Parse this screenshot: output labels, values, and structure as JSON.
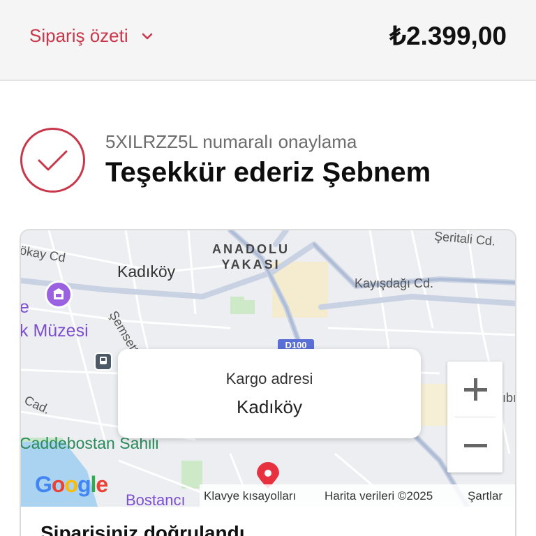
{
  "header": {
    "summary_label": "Sipariş özeti",
    "total": "₺2.399,00"
  },
  "confirmation": {
    "number_text": "5XILRZZ5L numaralı onaylama",
    "thanks_text": "Teşekkür ederiz Şebnem"
  },
  "map": {
    "labels": {
      "kadikoy": "Kadıköy",
      "anadolu": "ANADOLU",
      "yakasi": "YAKASI",
      "seritali": "Şeritali Cd.",
      "okay_cd": "ökay Cd",
      "kayisdagi": "Kayışdağı Cd.",
      "semsettin": "Şemsett",
      "muzesi": "k Müzesi",
      "e_label": "e",
      "cad": "Cad.",
      "caddebostan": "Caddebostan Sahili",
      "bostanci": "Bostancı",
      "ib": "ıbı",
      "highway": "D100"
    },
    "popup": {
      "title": "Kargo adresi",
      "value": "Kadıköy"
    },
    "zoom_in": "+",
    "zoom_out": "−",
    "attribution": {
      "shortcuts": "Klavye kısayolları",
      "data": "Harita verileri ©2025",
      "terms": "Şartlar"
    },
    "logo": "Google"
  },
  "order": {
    "verified_text": "Siparişiniz doğrulandı"
  },
  "colors": {
    "accent": "#c8374a",
    "pin": "#e8313f"
  }
}
